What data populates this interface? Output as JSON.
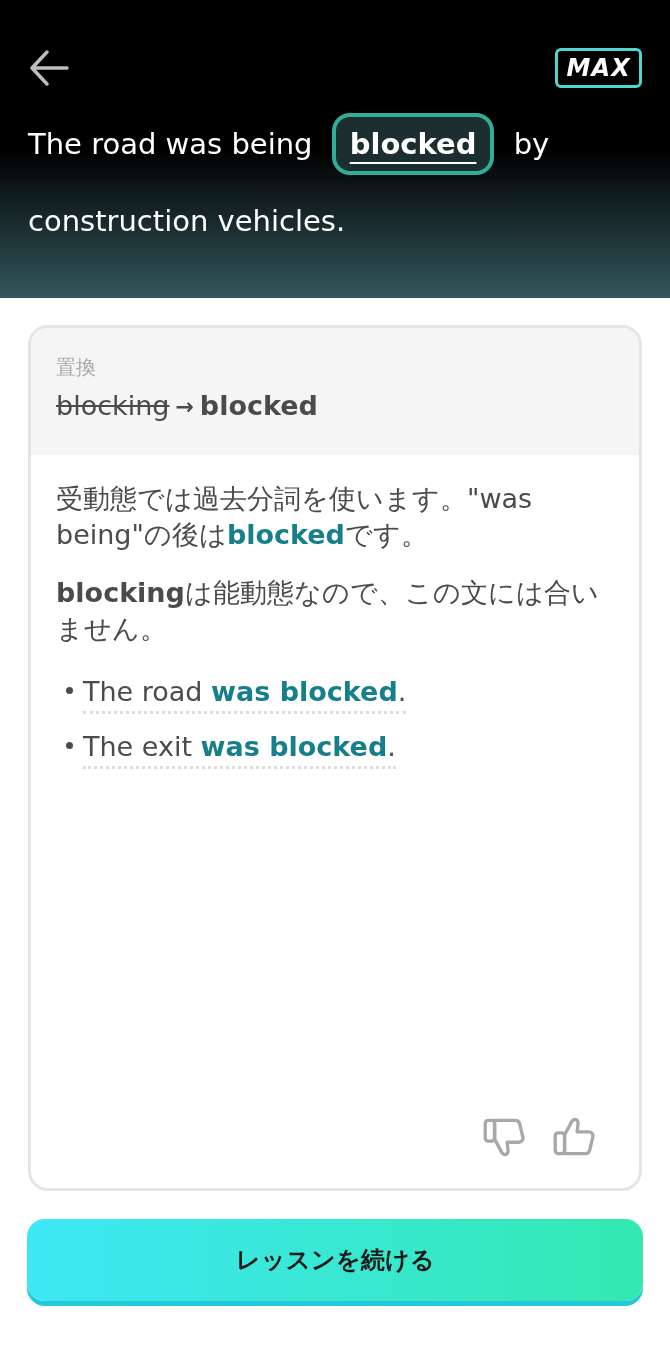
{
  "header": {
    "badge": "MAX",
    "sentence_before": "The road was being",
    "answer": "blocked",
    "sentence_after": [
      "by",
      "construction vehicles."
    ]
  },
  "card": {
    "category": "置換",
    "original": "blocking",
    "arrow": "→",
    "replacement": "blocked",
    "paragraphs": [
      {
        "kind": "accent",
        "text": "受動態では過去分詞を使います。\"was being\"の後は**blocked**です。"
      },
      {
        "kind": "plain",
        "text": "**blocking**は能動態なので、この文には合いません。"
      }
    ],
    "examples": [
      "The road **was blocked**.",
      "The exit **was blocked**."
    ]
  },
  "continue_button": "レッスンを続ける"
}
